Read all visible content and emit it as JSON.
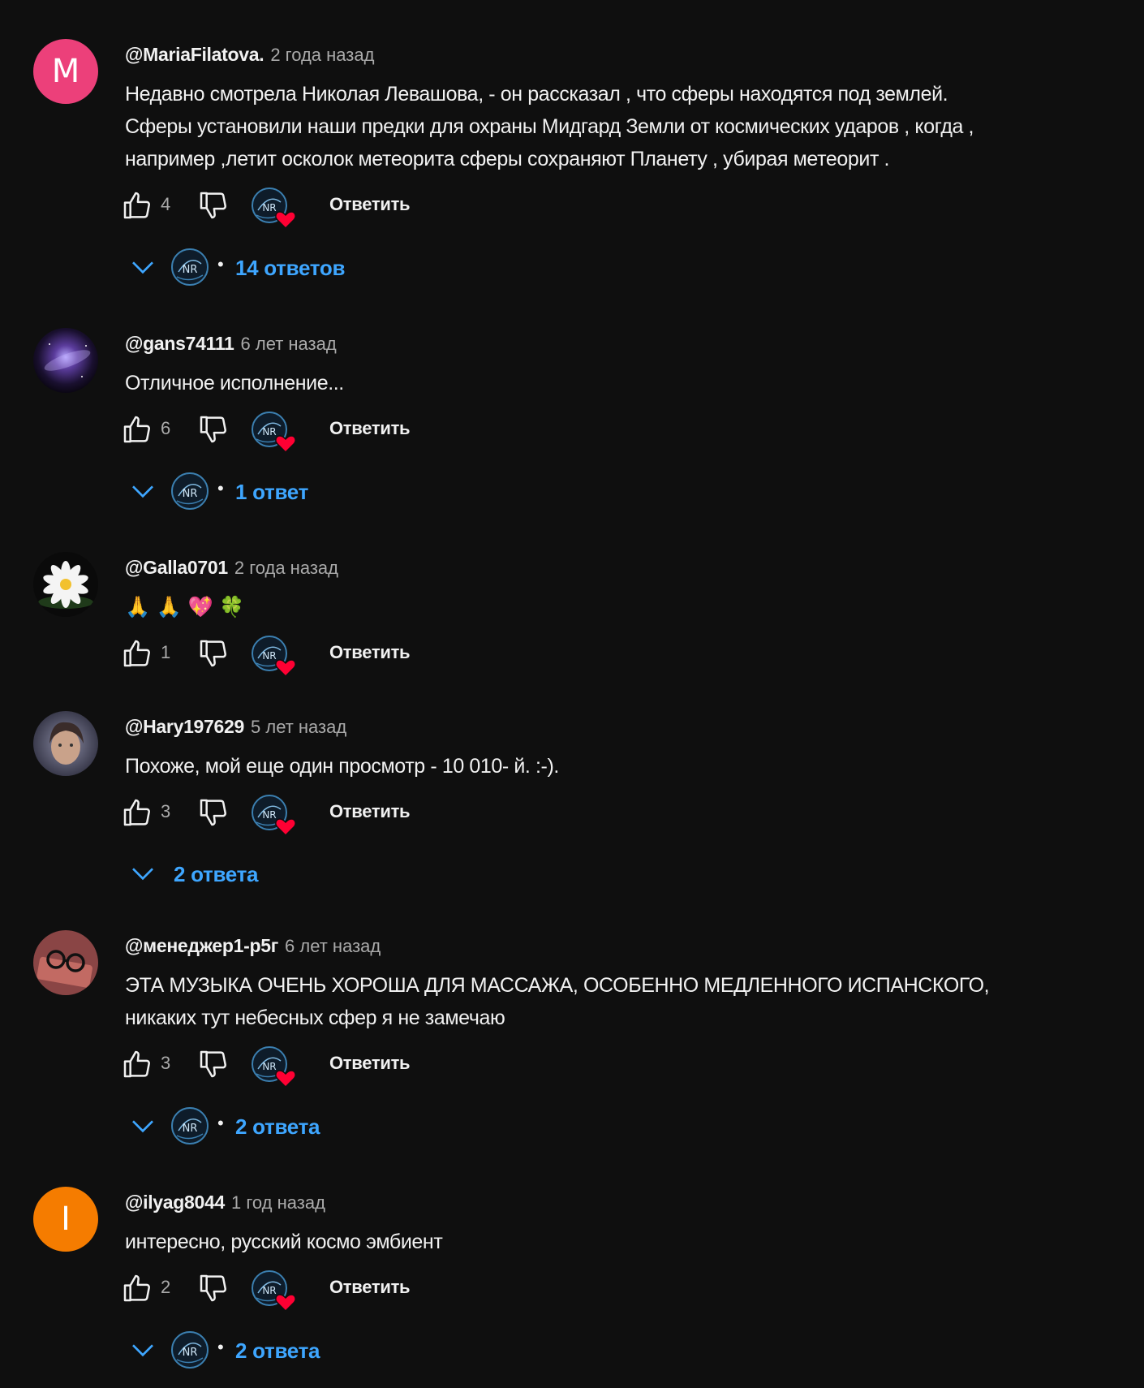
{
  "reply_label": "Ответить",
  "colors": {
    "background": "#0f0f0f",
    "link": "#3ea6ff",
    "heart": "#ff0033"
  },
  "comments": [
    {
      "author": "@MariaFilatova.",
      "date": "2 года назад",
      "avatar": {
        "type": "letter",
        "letter": "M",
        "color": "#ec407a"
      },
      "text_lines": [
        "Недавно смотрела Николая Левашова, - он рассказал , что сферы находятся под землей.",
        "Сферы установили наши предки для охраны Мидгард Земли от космических  ударов , когда ,",
        "например ,летит осколок метеорита сферы сохраняют Планету , убирая метеорит ."
      ],
      "likes": "4",
      "replies": {
        "label": "14 ответов",
        "show_creator_avatar": true
      }
    },
    {
      "author": "@gans74111",
      "date": "6 лет назад",
      "avatar": {
        "type": "image",
        "icon": "galaxy-avatar"
      },
      "text_lines": [
        "Отличное исполнение..."
      ],
      "likes": "6",
      "replies": {
        "label": "1 ответ",
        "show_creator_avatar": true
      }
    },
    {
      "author": "@Galla0701",
      "date": "2 года назад",
      "avatar": {
        "type": "image",
        "icon": "lotus-avatar"
      },
      "emojis": [
        "🙏",
        "🙏",
        "💖",
        "🍀"
      ],
      "likes": "1",
      "replies": null
    },
    {
      "author": "@Hary197629",
      "date": "5 лет назад",
      "avatar": {
        "type": "image",
        "icon": "portrait-avatar"
      },
      "text_lines": [
        "Похоже, мой еще один просмотр - 10 010- й. :-)."
      ],
      "likes": "3",
      "replies": {
        "label": "2 ответа",
        "show_creator_avatar": false
      }
    },
    {
      "author": "@менеджер1-р5г",
      "date": "6 лет назад",
      "avatar": {
        "type": "image",
        "icon": "glasses-avatar"
      },
      "text_lines": [
        "ЭТА МУЗЫКА ОЧЕНЬ ХОРОША ДЛЯ МАССАЖА, ОСОБЕННО МЕДЛЕННОГО ИСПАНСКОГО,",
        "никаких тут небесных сфер я не замечаю"
      ],
      "likes": "3",
      "replies": {
        "label": "2 ответа",
        "show_creator_avatar": true
      }
    },
    {
      "author": "@ilyag8044",
      "date": "1 год назад",
      "avatar": {
        "type": "letter",
        "letter": "I",
        "color": "#f57c00"
      },
      "text_lines": [
        "интересно, русский космо эмбиент"
      ],
      "likes": "2",
      "replies": {
        "label": "2 ответа",
        "show_creator_avatar": true
      }
    }
  ]
}
